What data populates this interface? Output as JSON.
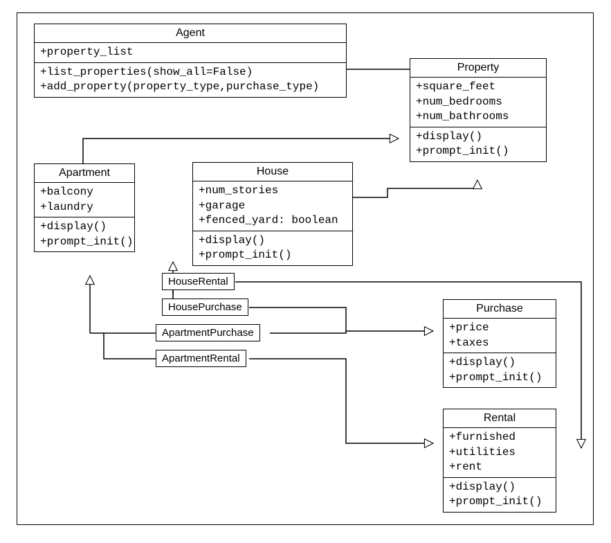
{
  "classes": {
    "agent": {
      "name": "Agent",
      "attrs": [
        "+property_list"
      ],
      "methods": [
        "+list_properties(show_all=False)",
        "+add_property(property_type,purchase_type)"
      ]
    },
    "property": {
      "name": "Property",
      "attrs": [
        "+square_feet",
        "+num_bedrooms",
        "+num_bathrooms"
      ],
      "methods": [
        "+display()",
        "+prompt_init()"
      ]
    },
    "apartment": {
      "name": "Apartment",
      "attrs": [
        "+balcony",
        "+laundry"
      ],
      "methods": [
        "+display()",
        "+prompt_init()"
      ]
    },
    "house": {
      "name": "House",
      "attrs": [
        "+num_stories",
        "+garage",
        "+fenced_yard: boolean"
      ],
      "methods": [
        "+display()",
        "+prompt_init()"
      ]
    },
    "purchase": {
      "name": "Purchase",
      "attrs": [
        "+price",
        "+taxes"
      ],
      "methods": [
        "+display()",
        "+prompt_init()"
      ]
    },
    "rental": {
      "name": "Rental",
      "attrs": [
        "+furnished",
        "+utilities",
        "+rent"
      ],
      "methods": [
        "+display()",
        "+prompt_init()"
      ]
    }
  },
  "assoc": {
    "house_rental": "HouseRental",
    "house_purchase": "HousePurchase",
    "apartment_purchase": "ApartmentPurchase",
    "apartment_rental": "ApartmentRental"
  },
  "chart_data": {
    "type": "uml-class-diagram",
    "classes": [
      {
        "name": "Agent",
        "attributes": [
          "property_list"
        ],
        "methods": [
          "list_properties(show_all=False)",
          "add_property(property_type,purchase_type)"
        ]
      },
      {
        "name": "Property",
        "attributes": [
          "square_feet",
          "num_bedrooms",
          "num_bathrooms"
        ],
        "methods": [
          "display()",
          "prompt_init()"
        ]
      },
      {
        "name": "Apartment",
        "attributes": [
          "balcony",
          "laundry"
        ],
        "methods": [
          "display()",
          "prompt_init()"
        ]
      },
      {
        "name": "House",
        "attributes": [
          "num_stories",
          "garage",
          "fenced_yard: boolean"
        ],
        "methods": [
          "display()",
          "prompt_init()"
        ]
      },
      {
        "name": "Purchase",
        "attributes": [
          "price",
          "taxes"
        ],
        "methods": [
          "display()",
          "prompt_init()"
        ]
      },
      {
        "name": "Rental",
        "attributes": [
          "furnished",
          "utilities",
          "rent"
        ],
        "methods": [
          "display()",
          "prompt_init()"
        ]
      },
      {
        "name": "HouseRental"
      },
      {
        "name": "HousePurchase"
      },
      {
        "name": "ApartmentPurchase"
      },
      {
        "name": "ApartmentRental"
      }
    ],
    "relationships": [
      {
        "from": "Agent",
        "to": "Property",
        "type": "association"
      },
      {
        "from": "Apartment",
        "to": "Property",
        "type": "inheritance"
      },
      {
        "from": "House",
        "to": "Property",
        "type": "inheritance"
      },
      {
        "from": "HouseRental",
        "to": "House",
        "type": "inheritance"
      },
      {
        "from": "HouseRental",
        "to": "Rental",
        "type": "inheritance"
      },
      {
        "from": "HousePurchase",
        "to": "House",
        "type": "inheritance"
      },
      {
        "from": "HousePurchase",
        "to": "Purchase",
        "type": "inheritance"
      },
      {
        "from": "ApartmentPurchase",
        "to": "Apartment",
        "type": "inheritance"
      },
      {
        "from": "ApartmentPurchase",
        "to": "Purchase",
        "type": "inheritance"
      },
      {
        "from": "ApartmentRental",
        "to": "Apartment",
        "type": "inheritance"
      },
      {
        "from": "ApartmentRental",
        "to": "Rental",
        "type": "inheritance"
      }
    ]
  }
}
